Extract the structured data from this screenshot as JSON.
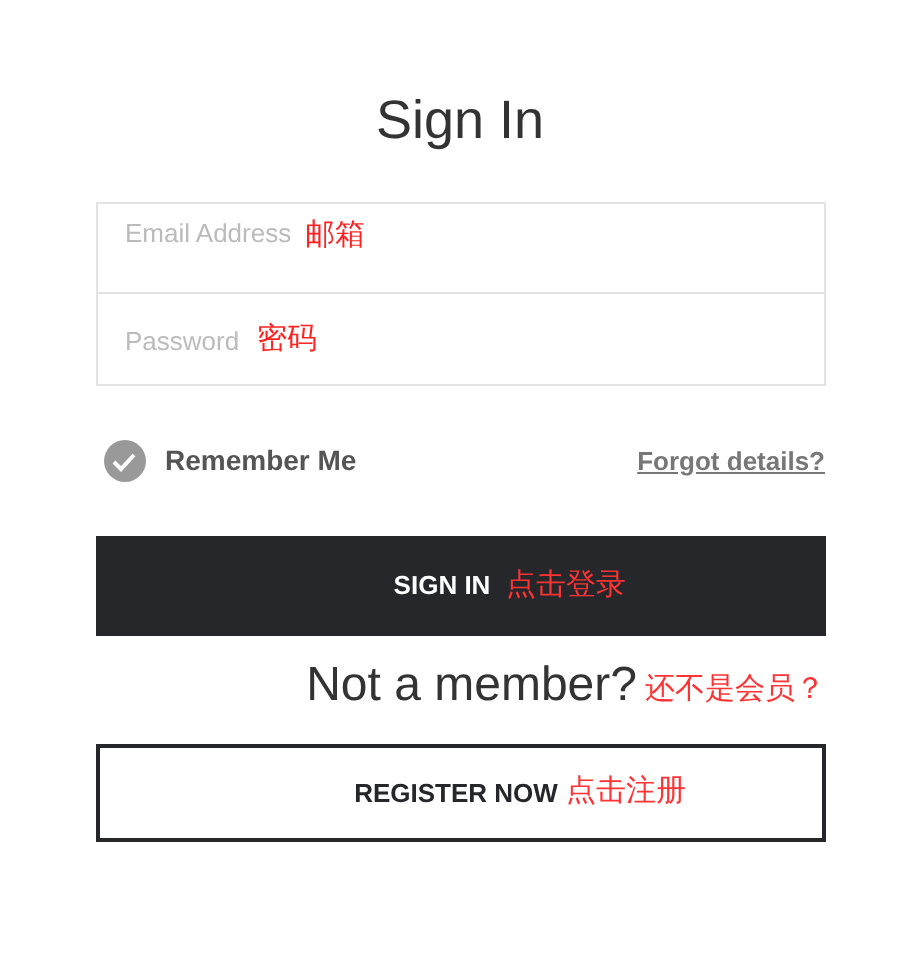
{
  "title": "Sign In",
  "fields": [
    {
      "placeholder": "Email Address",
      "annotation": "邮箱"
    },
    {
      "placeholder": "Password",
      "annotation": "密码"
    }
  ],
  "remember": {
    "label": "Remember Me",
    "checked": true
  },
  "forgot_link": "Forgot details?",
  "sign_in_button": {
    "label": "SIGN IN",
    "annotation": "点击登录"
  },
  "member_prompt": {
    "text": "Not a member?",
    "annotation": "还不是会员？"
  },
  "register_button": {
    "label": "REGISTER NOW",
    "annotation": "点击注册"
  }
}
